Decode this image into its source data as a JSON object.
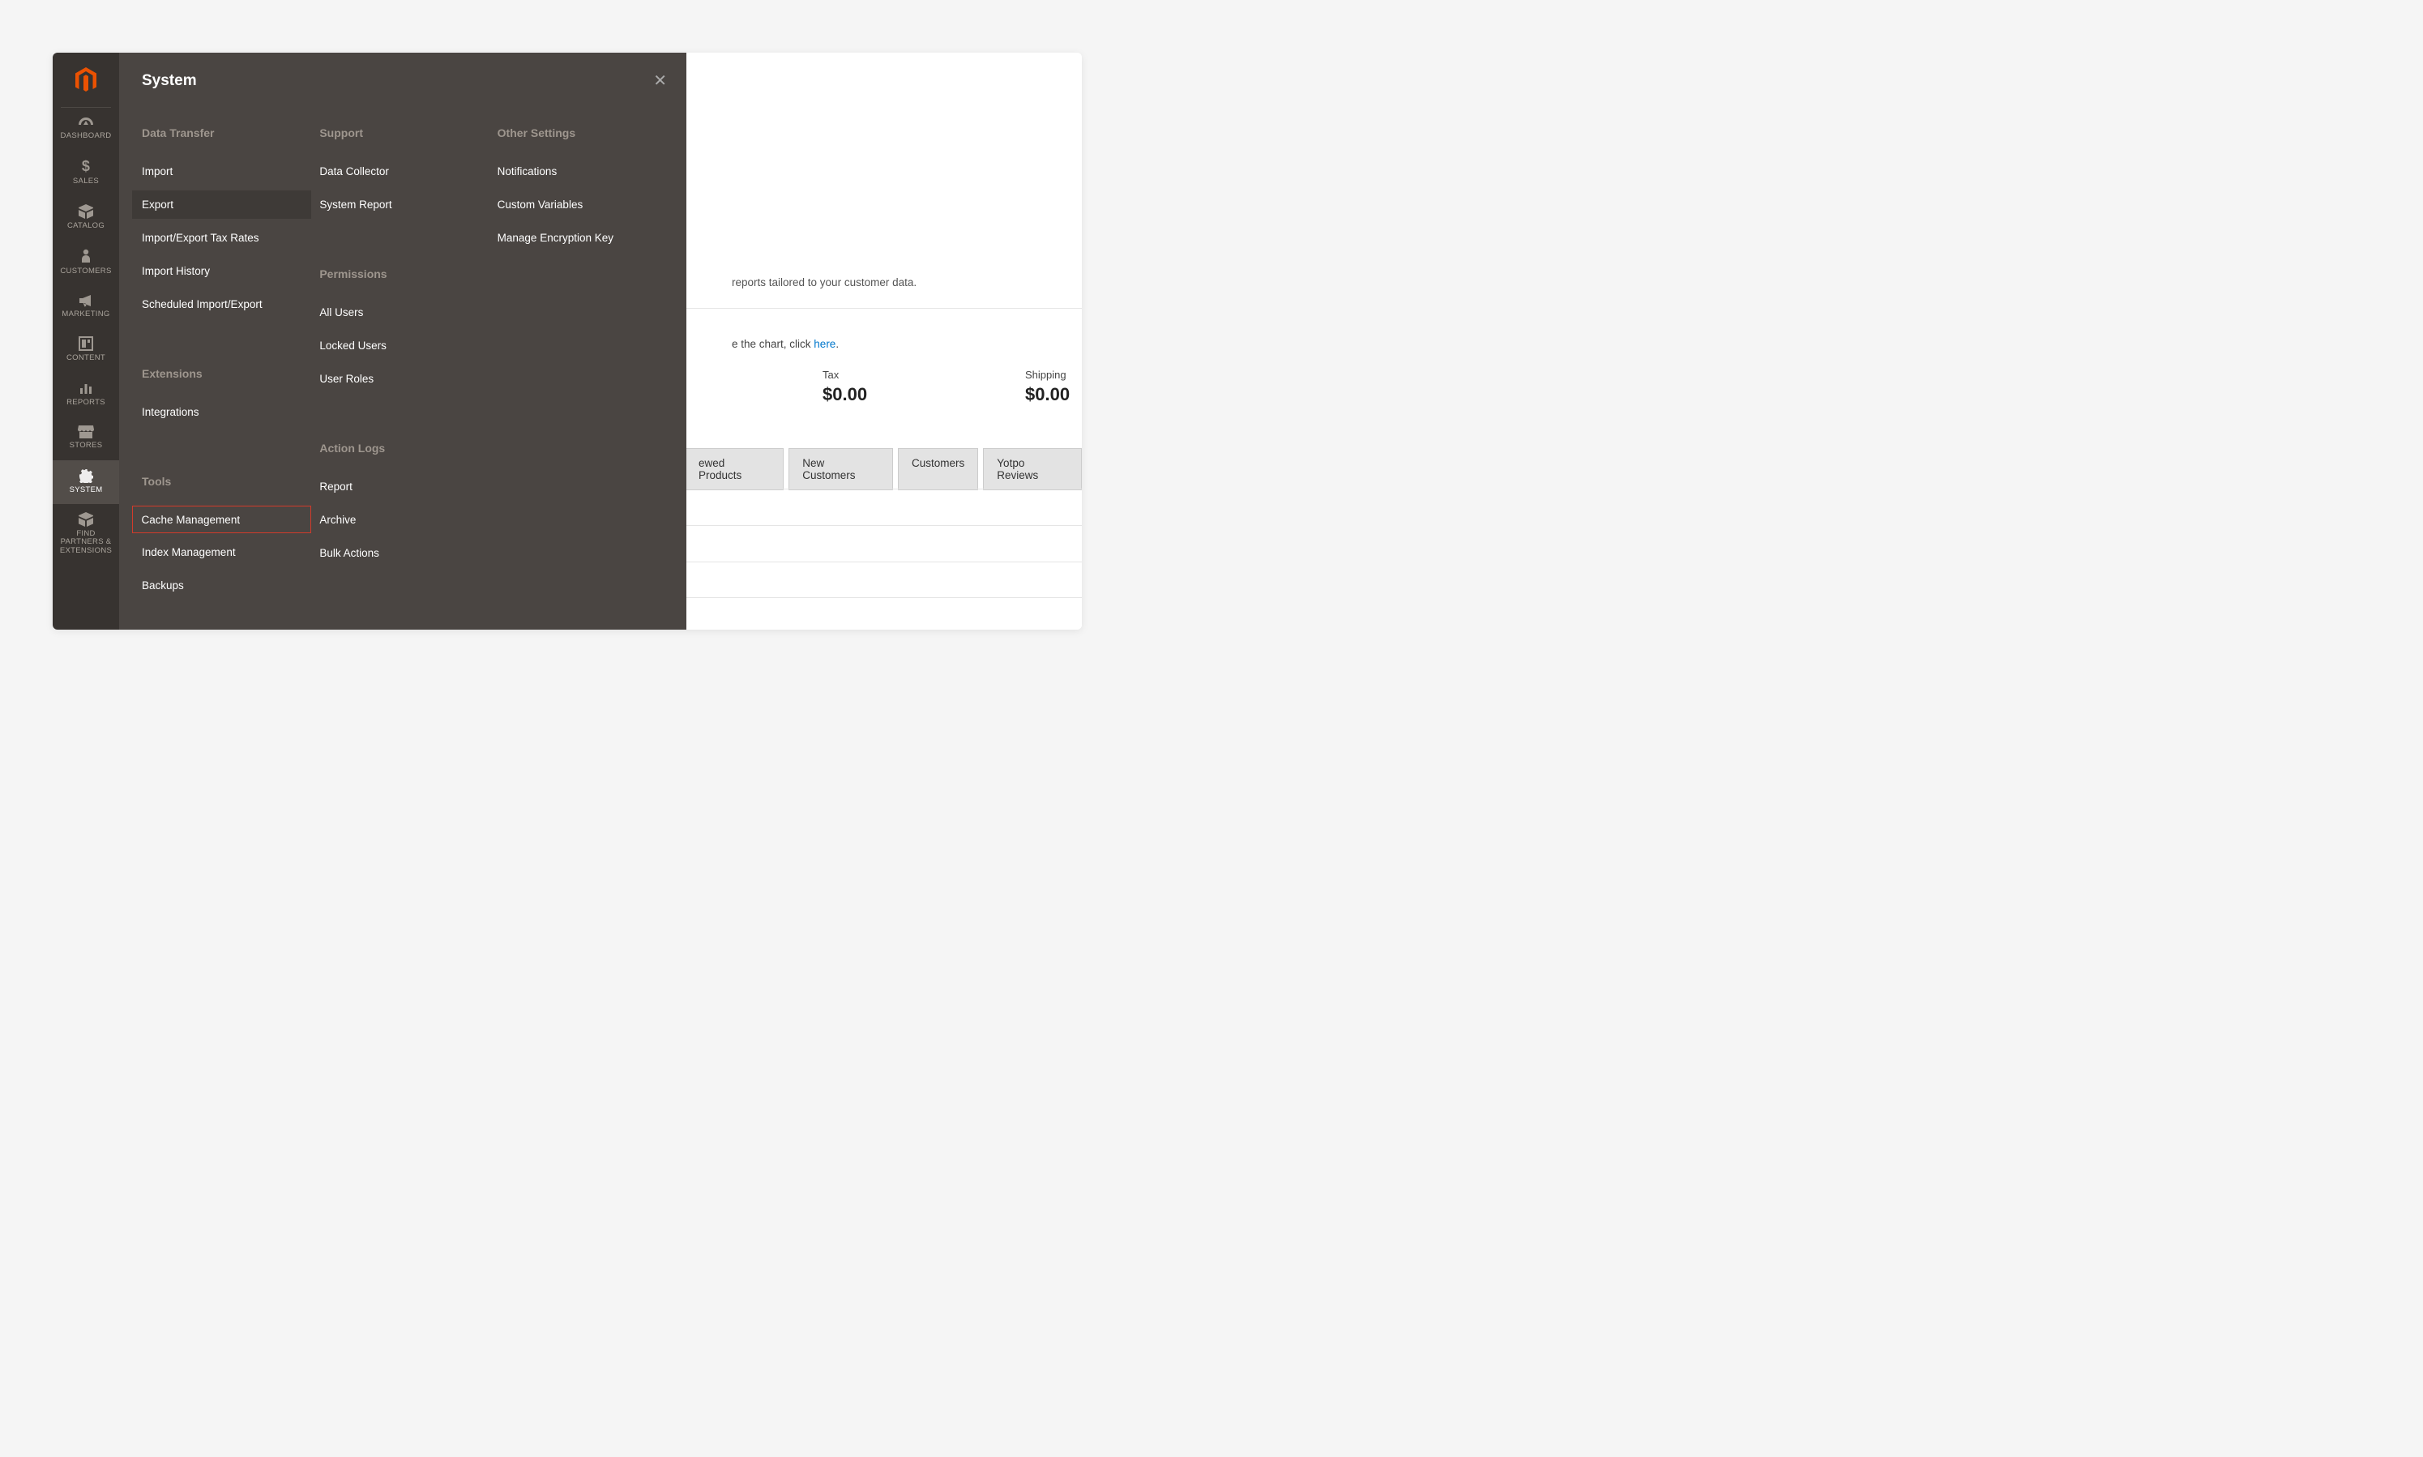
{
  "sidebar": {
    "items": [
      {
        "id": "dashboard",
        "label": "DASHBOARD"
      },
      {
        "id": "sales",
        "label": "SALES"
      },
      {
        "id": "catalog",
        "label": "CATALOG"
      },
      {
        "id": "customers",
        "label": "CUSTOMERS"
      },
      {
        "id": "marketing",
        "label": "MARKETING"
      },
      {
        "id": "content",
        "label": "CONTENT"
      },
      {
        "id": "reports",
        "label": "REPORTS"
      },
      {
        "id": "stores",
        "label": "STORES"
      },
      {
        "id": "system",
        "label": "SYSTEM",
        "active": true
      },
      {
        "id": "partners",
        "label": "FIND PARTNERS & EXTENSIONS"
      }
    ]
  },
  "flyout": {
    "title": "System",
    "sections": {
      "data_transfer": {
        "heading": "Data Transfer",
        "items": [
          "Import",
          "Export",
          "Import/Export Tax Rates",
          "Import History",
          "Scheduled Import/Export"
        ]
      },
      "extensions": {
        "heading": "Extensions",
        "items": [
          "Integrations"
        ]
      },
      "tools": {
        "heading": "Tools",
        "items": [
          "Cache Management",
          "Index Management",
          "Backups"
        ]
      },
      "support": {
        "heading": "Support",
        "items": [
          "Data Collector",
          "System Report"
        ]
      },
      "permissions": {
        "heading": "Permissions",
        "items": [
          "All Users",
          "Locked Users",
          "User Roles"
        ]
      },
      "action_logs": {
        "heading": "Action Logs",
        "items": [
          "Report",
          "Archive",
          "Bulk Actions"
        ]
      },
      "other_settings": {
        "heading": "Other Settings",
        "items": [
          "Notifications",
          "Custom Variables",
          "Manage Encryption Key"
        ]
      }
    },
    "hovered_item": "Export",
    "highlighted_item": "Cache Management"
  },
  "dashboard": {
    "bi_hint": "reports tailored to your customer data.",
    "chart_hint_prefix": "e the chart, click ",
    "chart_hint_link": "here",
    "stats": {
      "tax": {
        "label": "Tax",
        "value": "$0.00"
      },
      "shipping": {
        "label": "Shipping",
        "value": "$0.00"
      }
    },
    "tabs": [
      "ewed Products",
      "New Customers",
      "Customers",
      "Yotpo Reviews"
    ]
  }
}
